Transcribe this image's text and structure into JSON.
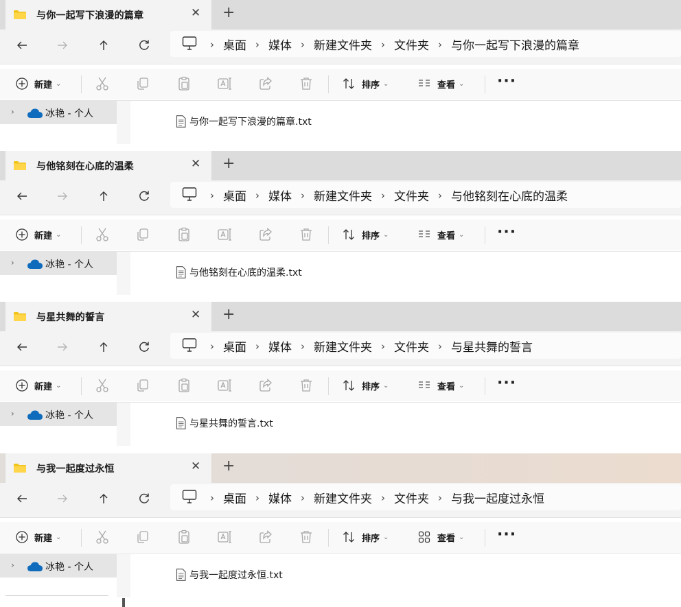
{
  "windows": [
    {
      "tab_title": "与你一起写下浪漫的篇章",
      "breadcrumb": [
        "桌面",
        "媒体",
        "新建文件夹",
        "文件夹",
        "与你一起写下浪漫的篇章"
      ],
      "view_icon": "list-view-icon",
      "nav_item": "冰艳 - 个人",
      "file_name": "与你一起写下浪漫的篇章.txt"
    },
    {
      "tab_title": "与他铭刻在心底的温柔",
      "breadcrumb": [
        "桌面",
        "媒体",
        "新建文件夹",
        "文件夹",
        "与他铭刻在心底的温柔"
      ],
      "view_icon": "list-view-icon",
      "nav_item": "冰艳 - 个人",
      "file_name": "与他铭刻在心底的温柔.txt"
    },
    {
      "tab_title": "与星共舞的誓言",
      "breadcrumb": [
        "桌面",
        "媒体",
        "新建文件夹",
        "文件夹",
        "与星共舞的誓言"
      ],
      "view_icon": "list-view-icon",
      "nav_item": "冰艳 - 个人",
      "file_name": "与星共舞的誓言.txt"
    },
    {
      "tab_title": "与我一起度过永恒",
      "breadcrumb": [
        "桌面",
        "媒体",
        "新建文件夹",
        "文件夹",
        "与我一起度过永恒"
      ],
      "view_icon": "tiles-view-icon",
      "nav_item": "冰艳 - 个人",
      "file_name": "与我一起度过永恒.txt"
    }
  ],
  "toolbar": {
    "new_label": "新建",
    "sort_label": "排序",
    "view_label": "查看",
    "more_label": "···",
    "close_tab": "✕",
    "add_tab": "+"
  },
  "icons": [
    "folder-icon",
    "back-arrow-icon",
    "forward-arrow-icon",
    "up-arrow-icon",
    "refresh-icon",
    "this-pc-icon",
    "new-plus-icon",
    "cut-icon",
    "copy-icon",
    "paste-icon",
    "rename-icon",
    "share-icon",
    "delete-icon",
    "sort-icon",
    "onedrive-cloud-icon",
    "text-file-icon"
  ],
  "colors": {
    "folder": "#f0c419",
    "onedrive": "#0f6cbd",
    "titlebar": "#dcdcdc",
    "toolbar": "#f9f9f9"
  }
}
